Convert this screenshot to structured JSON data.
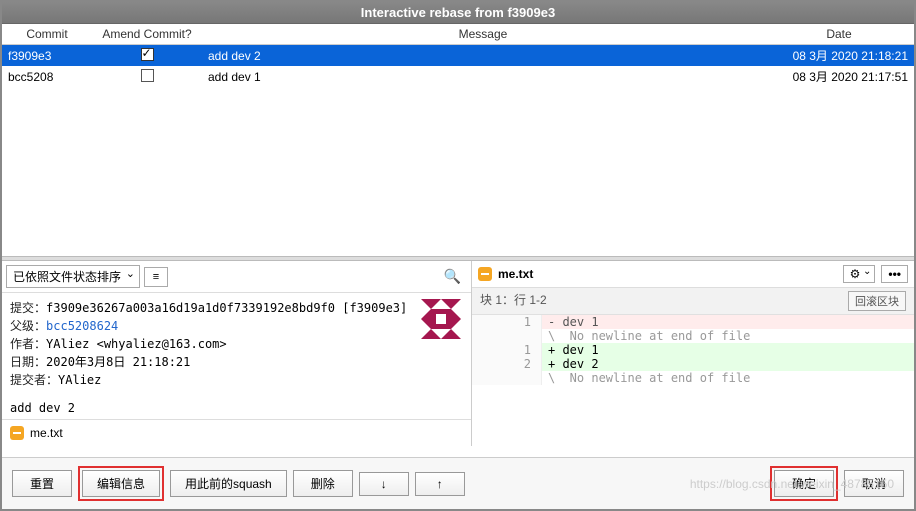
{
  "title": "Interactive rebase from f3909e3",
  "columns": {
    "commit": "Commit",
    "amend": "Amend Commit?",
    "message": "Message",
    "date": "Date"
  },
  "rows": [
    {
      "commit": "f3909e3",
      "amend": true,
      "message": "add dev 2",
      "date": "08 3月 2020 21:18:21",
      "selected": true
    },
    {
      "commit": "bcc5208",
      "amend": false,
      "message": "add  dev 1",
      "date": "08 3月 2020 21:17:51",
      "selected": false
    }
  ],
  "sort_label": "已依照文件状态排序",
  "commit_details": {
    "commit_label": "提交：",
    "commit_hash": "f3909e36267a003a16d19a1d0f7339192e8bd9f0 [f3909e3]",
    "parent_label": "父级：",
    "parent_hash": "bcc5208624",
    "author_label": "作者：",
    "author": "YAliez <whyaliez@163.com>",
    "date_label": "日期：",
    "date": "2020年3月8日 21:18:21",
    "committer_label": "提交者：",
    "committer": "YAliez",
    "message": "add dev 2"
  },
  "files": [
    {
      "name": "me.txt"
    }
  ],
  "diff": {
    "filename": "me.txt",
    "hunk_header": "块 1：行 1-2",
    "revert_label": "回滚区块",
    "lines": [
      {
        "old": "1",
        "new": "",
        "prefix": "-",
        "text": "dev 1",
        "cls": "del"
      },
      {
        "old": "",
        "new": "",
        "prefix": "\\",
        "text": " No newline at end of file",
        "cls": "nnl"
      },
      {
        "old": "",
        "new": "1",
        "prefix": "+",
        "text": "dev 1",
        "cls": "add"
      },
      {
        "old": "",
        "new": "2",
        "prefix": "+",
        "text": "dev 2",
        "cls": "add"
      },
      {
        "old": "",
        "new": "",
        "prefix": "\\",
        "text": " No newline at end of file",
        "cls": "nnl"
      }
    ]
  },
  "buttons": {
    "reset": "重置",
    "edit": "编辑信息",
    "squash": "用此前的squash",
    "delete": "删除",
    "down": "↓",
    "up": "↑",
    "ok": "确定",
    "cancel": "取消",
    "gear": "⚙",
    "more": "•••",
    "list": "≡"
  },
  "watermark": "https://blog.csdn.net/weixin_48785150"
}
